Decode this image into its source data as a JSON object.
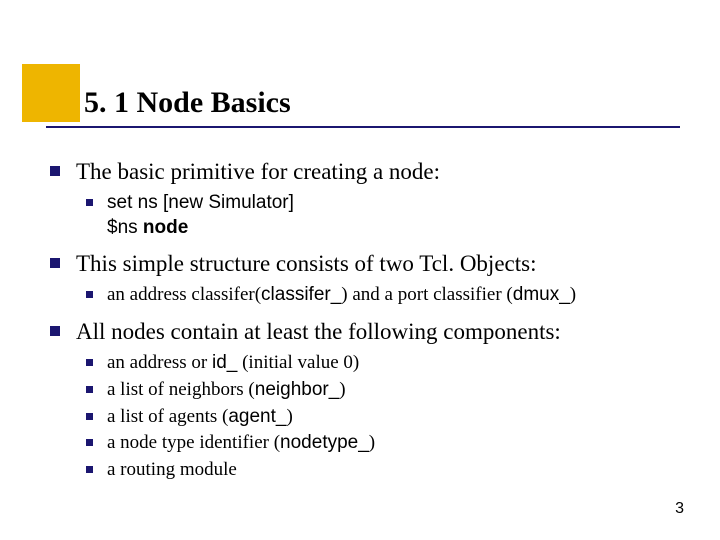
{
  "title": "5. 1   Node Basics",
  "bullets": {
    "b1": "The basic primitive for creating a node:",
    "b1a_1": " set ns [new Simulator]",
    "b1a_2": "$ns ",
    "b1a_2_bold": "node",
    "b2_pre": "This simple structure consists of two Tcl",
    "b2_post": "Objects:",
    "b2a_1": "an address classifer(",
    "b2a_2": "classifer_",
    "b2a_3": ") and a port classifier (",
    "b2a_4": "dmux_",
    "b2a_5": ")",
    "b3": "All nodes contain at least the following components:",
    "b3a_1": "an address or ",
    "b3a_2": "id_",
    "b3a_3": " (initial value 0)",
    "b3b_1": "a list of neighbors (",
    "b3b_2": "neighbor_",
    "b3b_3": ")",
    "b3c_1": "a list of agents (",
    "b3c_2": "agent_",
    "b3c_3": ")",
    "b3d_1": "a node type identifier (",
    "b3d_2": "nodetype_",
    "b3d_3": ")",
    "b3e": "a routing module"
  },
  "page": "3"
}
